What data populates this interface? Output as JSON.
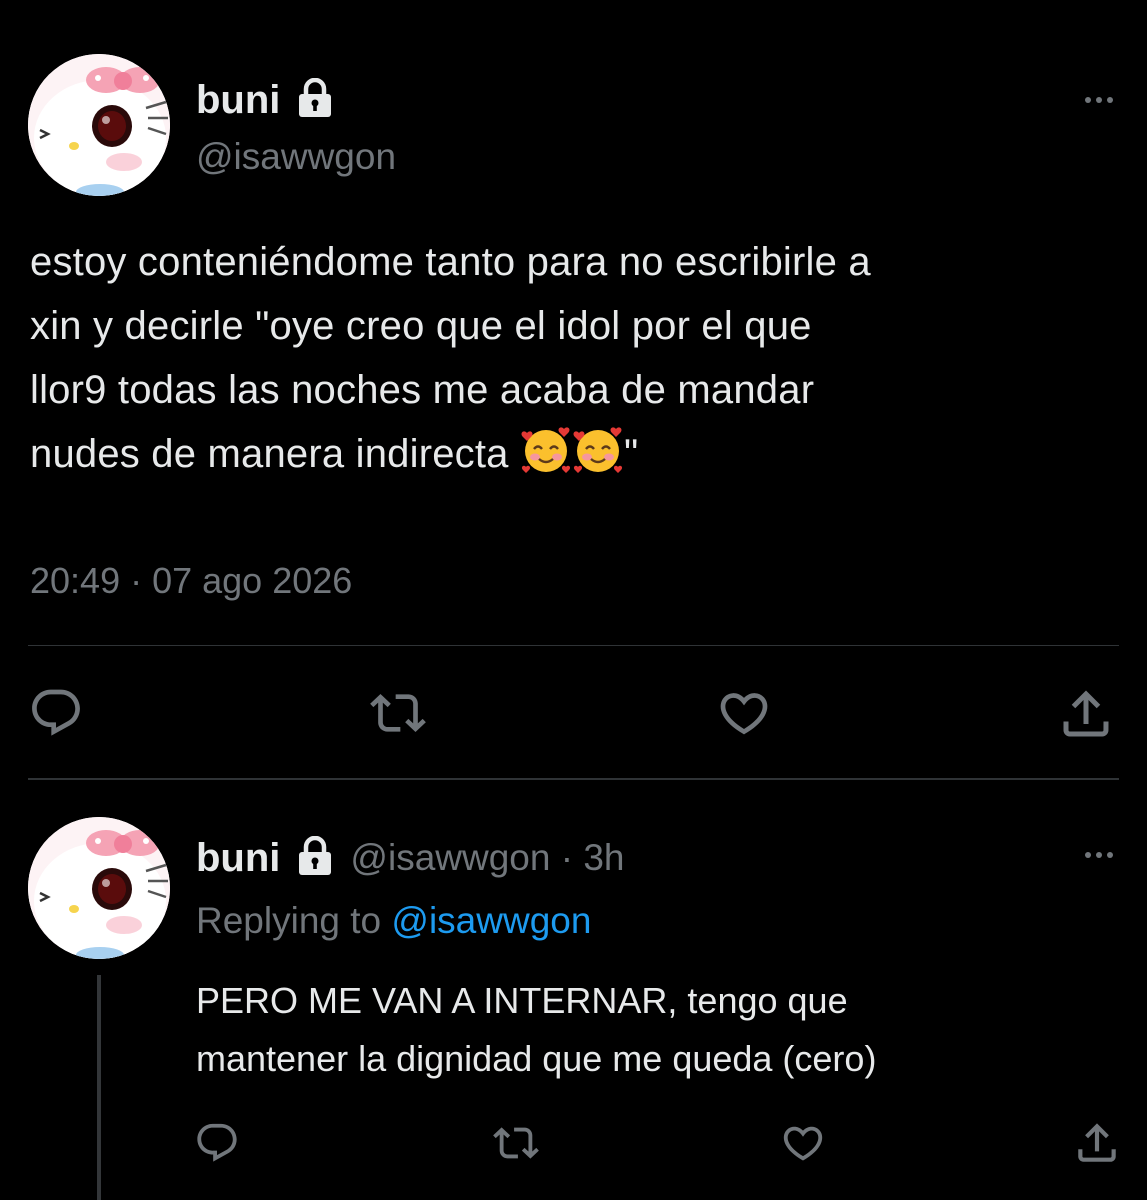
{
  "main_tweet": {
    "display_name": "buni",
    "handle": "@isawwgon",
    "text_lines": [
      "estoy conteniéndome tanto para no escribirle a",
      "xin y decirle \"oye creo que el idol por el que",
      "llor9 todas las noches me acaba de mandar",
      "nudes de manera indirecta"
    ],
    "text_end_quote": "\"",
    "emoji": "smiling-face-with-hearts",
    "timestamp": "20:49 · 07 ago 2026"
  },
  "reply_tweet": {
    "display_name": "buni",
    "handle_time": "@isawwgon · 3h",
    "replying_prefix": "Replying to",
    "replying_handle": "@isawwgon",
    "text_lines": [
      "PERO ME VAN A INTERNAR, tengo que",
      "mantener la dignidad que me queda (cero)"
    ]
  },
  "icons": {
    "lock": "lock-icon",
    "more": "more-dots-icon",
    "reply": "reply-icon",
    "retweet": "retweet-icon",
    "like": "heart-icon",
    "share": "share-icon"
  },
  "colors": {
    "background": "#000000",
    "text": "#e7e9ea",
    "secondary": "#71767b",
    "link": "#1d9bf0",
    "divider": "#2f3336"
  }
}
